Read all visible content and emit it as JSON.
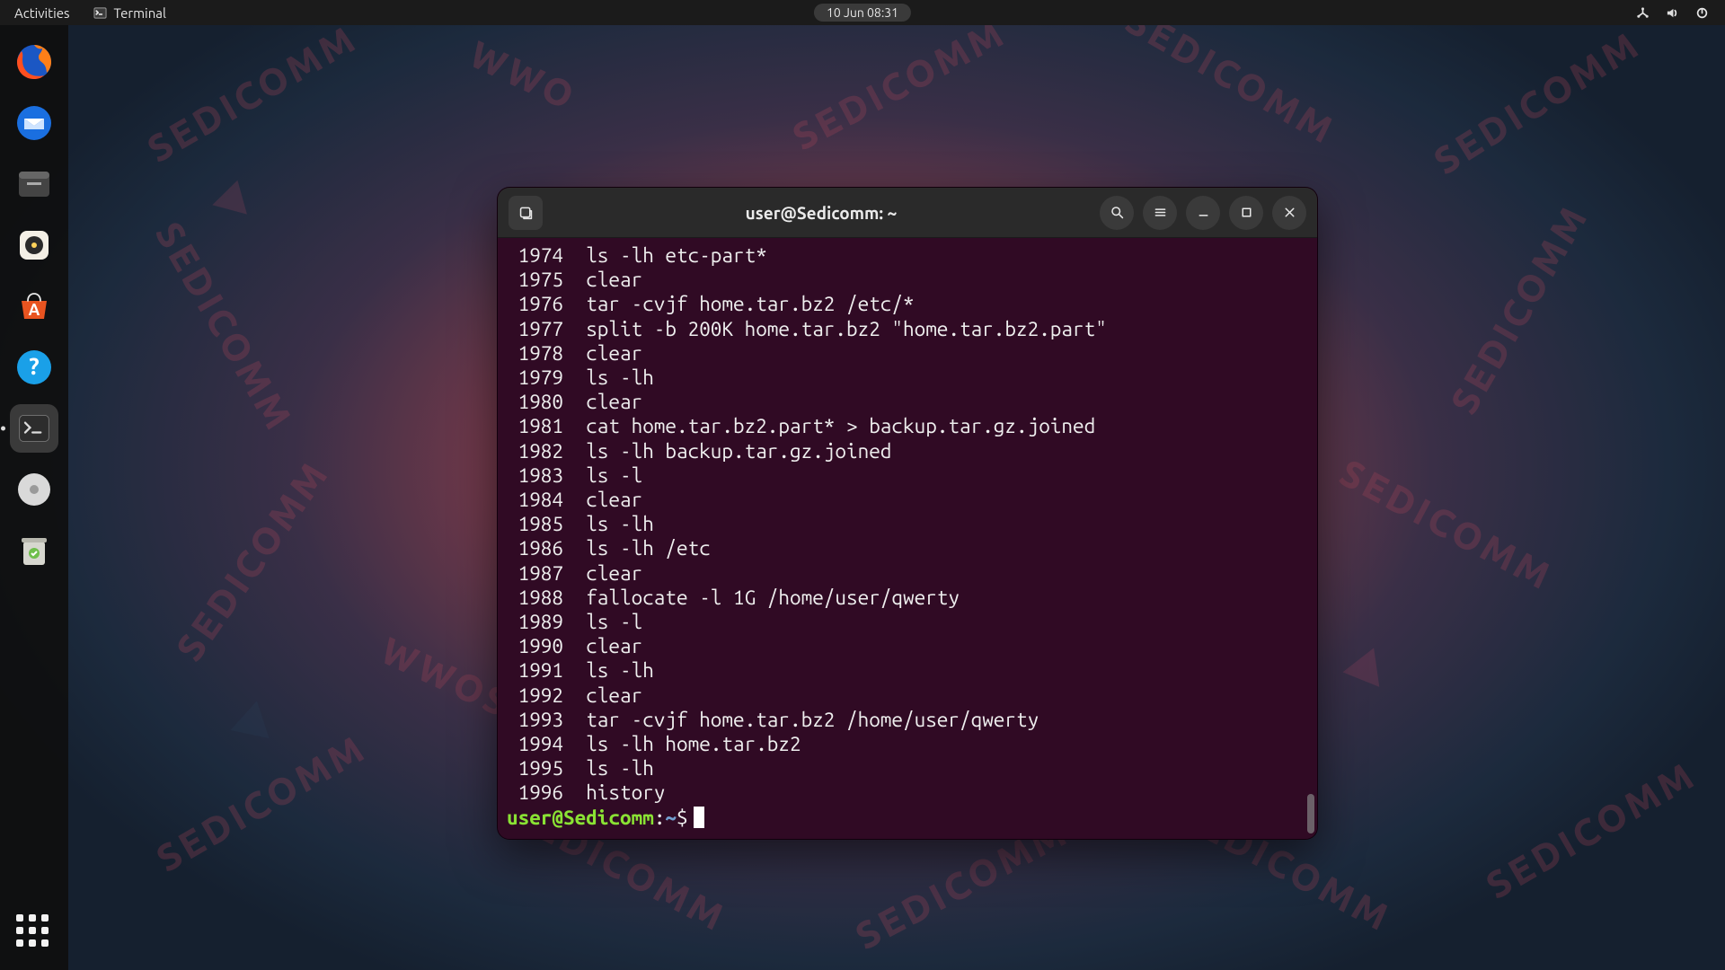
{
  "topbar": {
    "activities": "Activities",
    "app_label": "Terminal",
    "datetime": "10 Jun  08:31"
  },
  "dock": {
    "items": [
      {
        "name": "firefox"
      },
      {
        "name": "thunderbird"
      },
      {
        "name": "files"
      },
      {
        "name": "rhythmbox"
      },
      {
        "name": "software"
      },
      {
        "name": "help"
      },
      {
        "name": "terminal"
      },
      {
        "name": "disk"
      },
      {
        "name": "trash"
      }
    ]
  },
  "terminal": {
    "title": "user@Sedicomm: ~",
    "prompt_user": "user@Sedicomm",
    "prompt_sep": ":",
    "prompt_path": "~",
    "prompt_symbol": "$",
    "history": [
      {
        "n": "1974",
        "cmd": "ls -lh etc-part*"
      },
      {
        "n": "1975",
        "cmd": "clear"
      },
      {
        "n": "1976",
        "cmd": "tar -cvjf home.tar.bz2 /etc/*"
      },
      {
        "n": "1977",
        "cmd": "split -b 200K home.tar.bz2 \"home.tar.bz2.part\""
      },
      {
        "n": "1978",
        "cmd": "clear"
      },
      {
        "n": "1979",
        "cmd": "ls -lh"
      },
      {
        "n": "1980",
        "cmd": "clear"
      },
      {
        "n": "1981",
        "cmd": "cat home.tar.bz2.part* > backup.tar.gz.joined"
      },
      {
        "n": "1982",
        "cmd": "ls -lh backup.tar.gz.joined"
      },
      {
        "n": "1983",
        "cmd": "ls -l"
      },
      {
        "n": "1984",
        "cmd": "clear"
      },
      {
        "n": "1985",
        "cmd": "ls -lh"
      },
      {
        "n": "1986",
        "cmd": "ls -lh /etc"
      },
      {
        "n": "1987",
        "cmd": "clear"
      },
      {
        "n": "1988",
        "cmd": "fallocate -l 1G /home/user/qwerty"
      },
      {
        "n": "1989",
        "cmd": "ls -l"
      },
      {
        "n": "1990",
        "cmd": "clear"
      },
      {
        "n": "1991",
        "cmd": "ls -lh"
      },
      {
        "n": "1992",
        "cmd": "clear"
      },
      {
        "n": "1993",
        "cmd": "tar -cvjf home.tar.bz2 /home/user/qwerty"
      },
      {
        "n": "1994",
        "cmd": "ls -lh home.tar.bz2"
      },
      {
        "n": "1995",
        "cmd": "ls -lh"
      },
      {
        "n": "1996",
        "cmd": "history"
      }
    ]
  }
}
